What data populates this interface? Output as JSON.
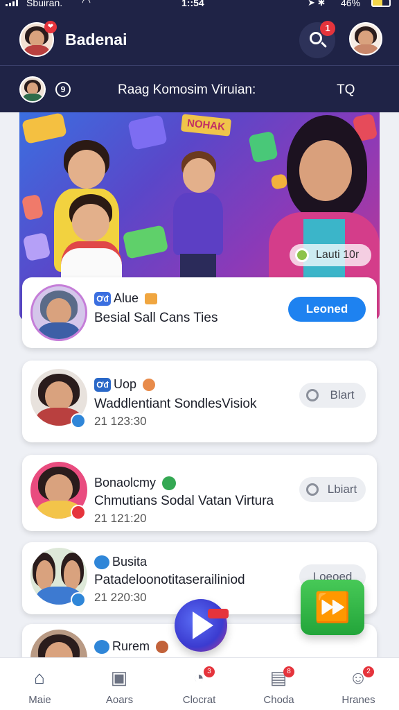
{
  "status_bar": {
    "carrier": "Sbuiran.",
    "time": "1::54",
    "battery_pct": "46%",
    "wifi_icon": "wifi-icon",
    "signal_icon": "signal-icon"
  },
  "header": {
    "title": "Badenai",
    "avatar_badge": "❤",
    "search_badge": "1"
  },
  "subbar": {
    "title": "Raag Komosim Viruian:",
    "action": "TQ"
  },
  "banner": {
    "tag": "NOHAK",
    "chip_label": "Lauti 10r"
  },
  "cards": [
    {
      "tag": "Alue",
      "tag_icon_text": "Ơđ",
      "title": "Besial Sall Cans Ties",
      "time": "",
      "button": "Leoned"
    },
    {
      "tag": "Uop",
      "tag_icon_text": "Ơđ",
      "title": "Waddlentiant SondlesVisiok",
      "time": "21 123:30",
      "button": "Blart"
    },
    {
      "tag": "Bonaolcmy",
      "tag_icon_text": "",
      "title": "Chmutians Sodal Vatan Virtura",
      "time": "21 121:20",
      "button": "Lbiart"
    },
    {
      "tag": "Busita",
      "tag_icon_text": "",
      "title": "Patadeloonotitaserailiniod",
      "time": "21 220:30",
      "button": "Loeoed"
    },
    {
      "tag": "Rurem",
      "tag_icon_text": "",
      "title": "",
      "time": "",
      "button": ""
    }
  ],
  "nav": [
    {
      "label": "Maie",
      "icon": "home-icon",
      "badge": ""
    },
    {
      "label": "Aoars",
      "icon": "box-icon",
      "badge": ""
    },
    {
      "label": "Clocrat",
      "icon": "chat-icon",
      "badge": "3"
    },
    {
      "label": "Choda",
      "icon": "calendar-icon",
      "badge": "8"
    },
    {
      "label": "Hranes",
      "icon": "profile-icon",
      "badge": "2"
    }
  ],
  "colors": {
    "header_bg": "#1f2346",
    "primary": "#1e82f0",
    "badge_red": "#e5343c",
    "fab_green": "#23a53a"
  }
}
